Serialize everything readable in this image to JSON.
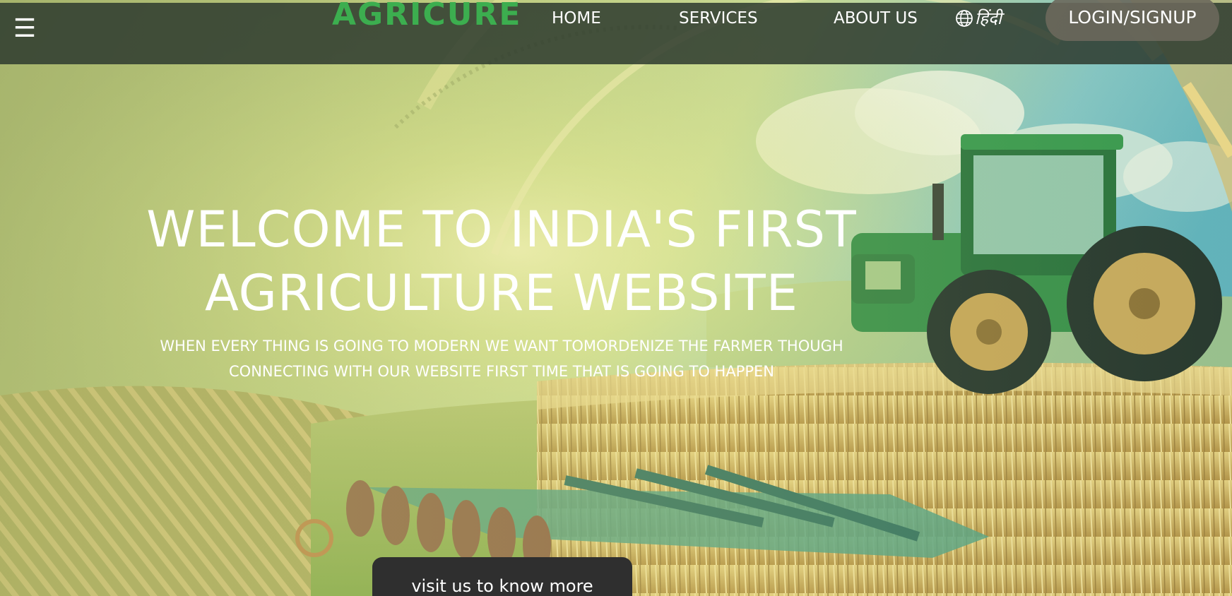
{
  "navbar": {
    "menu_icon": "hamburger-menu-icon",
    "menu_glyph": "☰",
    "brand": "AGRICURE",
    "links": [
      {
        "label": "HOME"
      },
      {
        "label": "SERVICES"
      },
      {
        "label": "ABOUT US"
      }
    ],
    "language": {
      "icon": "globe-icon",
      "label": "हिंदी"
    },
    "login_label": "LOGIN/SIGNUP"
  },
  "hero": {
    "title_line1": "WELCOME TO INDIA'S FIRST",
    "title_line2": "AGRICULTURE WEBSITE",
    "subtitle_line1": "WHEN EVERY THING IS GOING TO MODERN WE WANT TOMORDENIZE THE FARMER THOUGH",
    "subtitle_line2": "CONNECTING WITH OUR WEBSITE FIRST TIME THAT IS GOING TO HAPPEN",
    "cta_label": "visit us to know more"
  },
  "colors": {
    "brand": "#3cae4f",
    "navbar_bg": "#2d3a2e",
    "login_bg": "#6c685c",
    "cta_bg": "#2f2f2f",
    "text": "#ffffff"
  }
}
